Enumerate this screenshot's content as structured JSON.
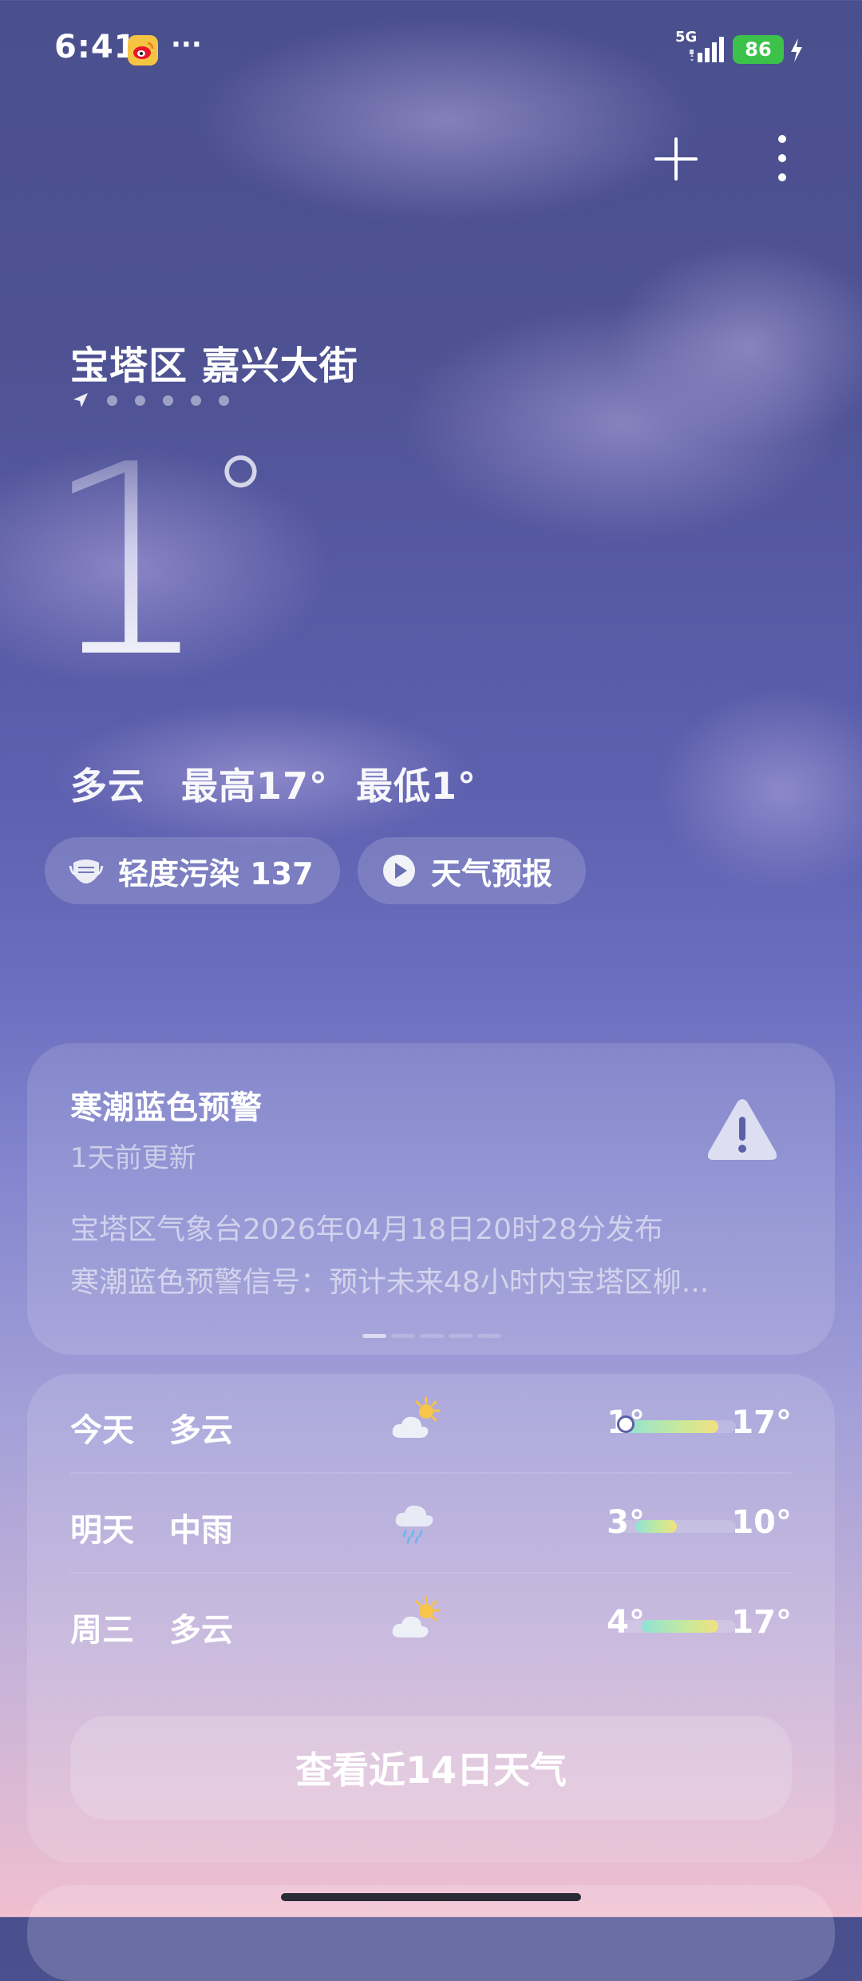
{
  "status_bar": {
    "time": "6:41",
    "more": "···",
    "network": "5G",
    "battery": "86",
    "battery_color": "#3cc24a",
    "icons": [
      "weibo-icon",
      "signal-icon",
      "charging-bolt-icon"
    ]
  },
  "toolbar": {
    "add_icon": "plus-icon",
    "menu_icon": "vertical-dots-icon"
  },
  "location": {
    "name": "宝塔区 嘉兴大街",
    "page_count": 6,
    "current_icon": "location-arrow-icon"
  },
  "current": {
    "temperature": "1",
    "degree": "°",
    "condition": "多云",
    "high_label": "最高17°",
    "low_label": "最低1°"
  },
  "chips": {
    "aqi": {
      "icon": "mask-icon",
      "label": "轻度污染 137"
    },
    "forecast_video": {
      "icon": "play-icon",
      "label": "天气预报"
    }
  },
  "alert": {
    "title": "寒潮蓝色预警",
    "updated": "1天前更新",
    "line1": "宝塔区气象台2026年04月18日20时28分发布",
    "line2": "寒潮蓝色预警信号：预计未来48小时内宝塔区柳...",
    "icon": "warning-triangle-icon",
    "pages": 5,
    "active_page": 0
  },
  "forecast": {
    "range_min": 0,
    "range_max": 20,
    "days": [
      {
        "day": "今天",
        "condition": "多云",
        "icon": "partly-cloudy-sun-icon",
        "low": "1°",
        "high": "17°",
        "low_value": 1,
        "high_value": 17,
        "now_value": 1
      },
      {
        "day": "明天",
        "condition": "中雨",
        "icon": "rain-cloud-icon",
        "low": "3°",
        "high": "10°",
        "low_value": 3,
        "high_value": 10
      },
      {
        "day": "周三",
        "condition": "多云",
        "icon": "partly-cloudy-sun-icon",
        "low": "4°",
        "high": "17°",
        "low_value": 4,
        "high_value": 17
      }
    ],
    "more_button": "查看近14日天气"
  }
}
